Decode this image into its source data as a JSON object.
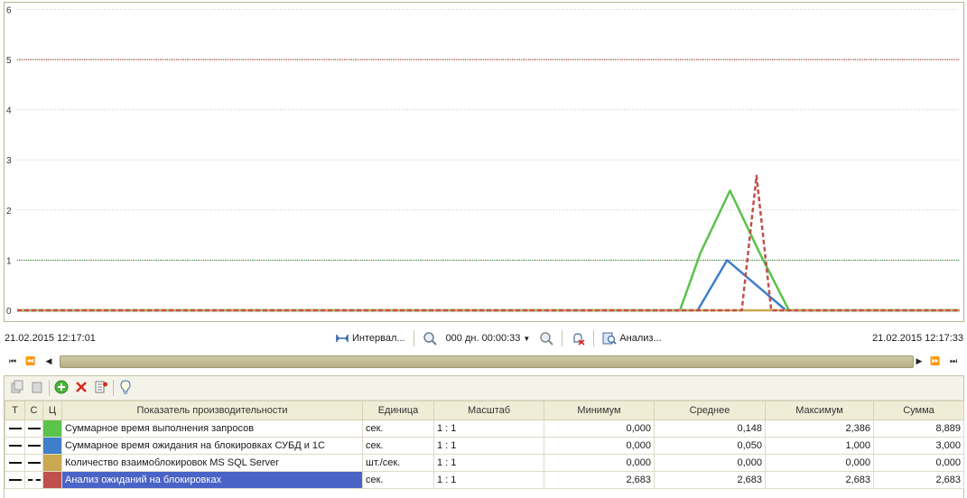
{
  "chart_data": {
    "type": "line",
    "y_ticks": [
      "0",
      "1",
      "2",
      "3",
      "4",
      "5",
      "6"
    ],
    "ylim": [
      0,
      6
    ],
    "threshold_lines": [
      {
        "value": 5,
        "color": "#8b1a1a"
      },
      {
        "value": 1,
        "color": "#2e7d2e"
      }
    ],
    "x_range": [
      "21.02.2015 12:17:01",
      "21.02.2015 12:17:33"
    ],
    "series": [
      {
        "name": "Суммарное время выполнения запросов",
        "color": "#5ac34a",
        "style": "solid",
        "x": [
          0,
          22.5,
          23.2,
          24.2,
          25.2,
          26.2,
          32
        ],
        "values": [
          0,
          0,
          1.15,
          2.386,
          1.15,
          0,
          0
        ]
      },
      {
        "name": "Суммарное время ожидания на блокировках СУБД и 1С",
        "color": "#3f7fc9",
        "style": "solid",
        "x": [
          0,
          23.1,
          24.1,
          25.1,
          26.1,
          32
        ],
        "values": [
          0,
          0,
          1.0,
          0.5,
          0,
          0
        ]
      },
      {
        "name": "Количество взаимоблокировок MS SQL Server",
        "color": "#c8a850",
        "style": "solid",
        "x": [
          0,
          32
        ],
        "values": [
          0,
          0
        ]
      },
      {
        "name": "Анализ ожиданий на блокировках",
        "color": "#c0504d",
        "style": "dashed",
        "x": [
          0,
          24.6,
          25.1,
          25.6,
          32
        ],
        "values": [
          0,
          0,
          2.683,
          0,
          0
        ]
      }
    ]
  },
  "timebar": {
    "start": "21.02.2015 12:17:01",
    "end": "21.02.2015 12:17:33",
    "interval_label": "Интервал...",
    "period_label": "000 дн. 00:00:33",
    "analysis_label": "Анализ..."
  },
  "table": {
    "headers": [
      "Т",
      "С",
      "Ц",
      "Показатель производительности",
      "Единица",
      "Масштаб",
      "Минимум",
      "Среднее",
      "Максимум",
      "Сумма"
    ],
    "rows": [
      {
        "name": "Суммарное время выполнения запросов",
        "unit": "сек.",
        "scale": "1 : 1",
        "min": "0,000",
        "avg": "0,148",
        "max": "2,386",
        "sum": "8,889",
        "color": "#5ac34a",
        "line": "solid"
      },
      {
        "name": "Суммарное время ожидания на блокировках СУБД и 1С",
        "unit": "сек.",
        "scale": "1 : 1",
        "min": "0,000",
        "avg": "0,050",
        "max": "1,000",
        "sum": "3,000",
        "color": "#3f7fc9",
        "line": "solid"
      },
      {
        "name": "Количество взаимоблокировок MS SQL Server",
        "unit": "шт./сек.",
        "scale": "1 : 1",
        "min": "0,000",
        "avg": "0,000",
        "max": "0,000",
        "sum": "0,000",
        "color": "#c8a850",
        "line": "solid"
      },
      {
        "name": "Анализ ожиданий на блокировках",
        "unit": "сек.",
        "scale": "1 : 1",
        "min": "2,683",
        "avg": "2,683",
        "max": "2,683",
        "sum": "2,683",
        "color": "#c0504d",
        "line": "dashed"
      }
    ]
  }
}
